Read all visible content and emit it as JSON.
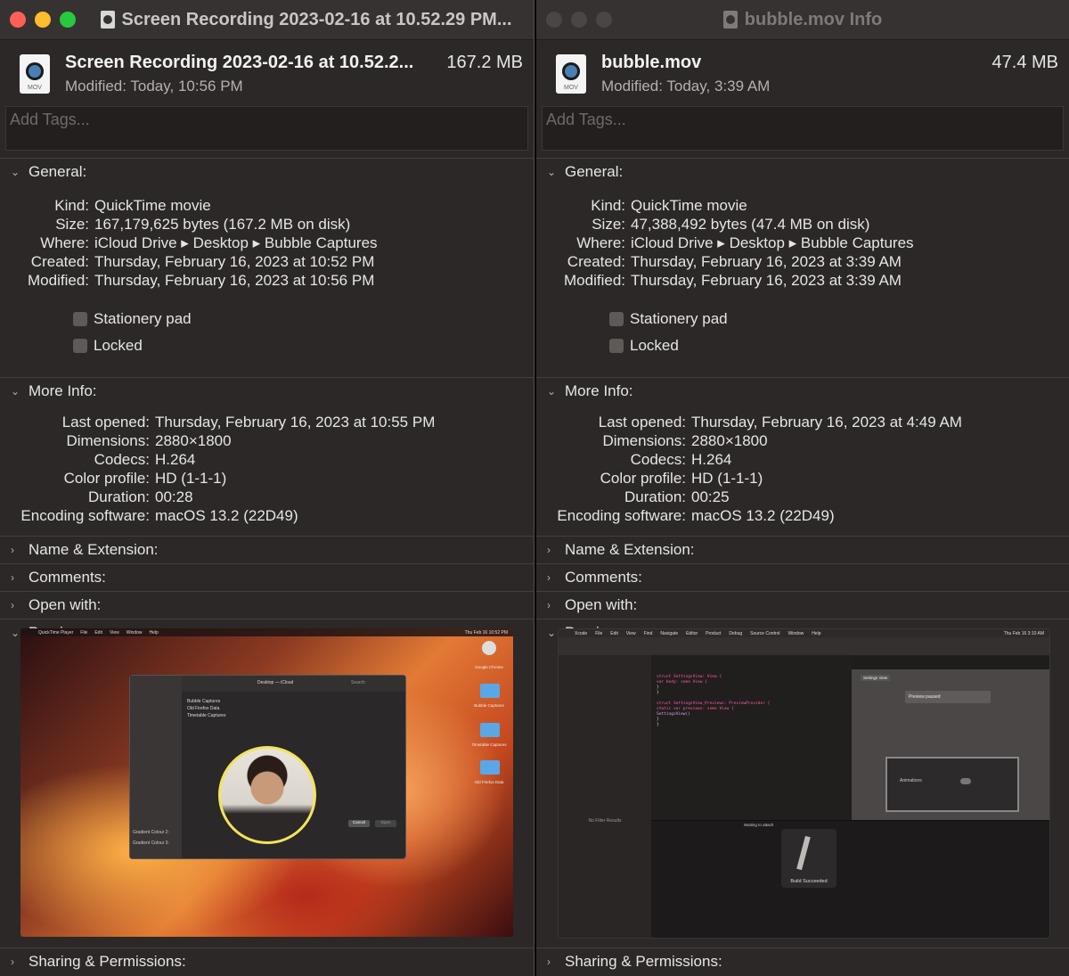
{
  "windows": [
    {
      "title": "Screen Recording 2023-02-16 at 10.52.29 PM...",
      "file_name": "Screen Recording 2023-02-16 at 10.52.2...",
      "size": "167.2 MB",
      "modified_line": "Modified:  Today, 10:56 PM",
      "tags_placeholder": "Add Tags...",
      "sections": {
        "general": "General:",
        "more_info": "More Info:",
        "name_ext": "Name & Extension:",
        "comments": "Comments:",
        "open_with": "Open with:",
        "preview": "Preview:",
        "sharing": "Sharing & Permissions:"
      },
      "general": {
        "kind_k": "Kind:",
        "kind": "QuickTime movie",
        "size_k": "Size:",
        "size": "167,179,625 bytes (167.2 MB on disk)",
        "where_k": "Where:",
        "where": "iCloud Drive ▸ Desktop ▸ Bubble Captures",
        "created_k": "Created:",
        "created": "Thursday, February 16, 2023 at 10:52 PM",
        "modified_k": "Modified:",
        "modified": "Thursday, February 16, 2023 at 10:56 PM",
        "stationery": "Stationery pad",
        "locked": "Locked"
      },
      "more_info": {
        "last_opened_k": "Last opened:",
        "last_opened": "Thursday, February 16, 2023 at 10:55 PM",
        "dimensions_k": "Dimensions:",
        "dimensions": "2880×1800",
        "codecs_k": "Codecs:",
        "codecs": "H.264",
        "color_profile_k": "Color profile:",
        "color_profile": "HD (1-1-1)",
        "duration_k": "Duration:",
        "duration": "00:28",
        "encoding_k": "Encoding software:",
        "encoding": "macOS 13.2 (22D49)"
      },
      "preview": {
        "menubar": [
          "QuickTime Player",
          "File",
          "Edit",
          "View",
          "Window",
          "Help"
        ],
        "clock": "Thu Feb 16  10:52 PM",
        "folders": [
          "Bubble Captures",
          "Old Firefox Data",
          "Timetable Captures"
        ],
        "desktop_icons": [
          "Google Chrome",
          "Bubble Captures",
          "Timetable Captures",
          "Old Firefox Data"
        ],
        "gradients": [
          "Gradient Colour 2:",
          "Gradient Colour 3:"
        ],
        "path": "Desktop — iCloud",
        "search": "Search",
        "cancel": "Cancel",
        "open": "Open"
      }
    },
    {
      "title": "bubble.mov Info",
      "file_name": "bubble.mov",
      "size": "47.4 MB",
      "modified_line": "Modified:  Today, 3:39 AM",
      "tags_placeholder": "Add Tags...",
      "sections": {
        "general": "General:",
        "more_info": "More Info:",
        "name_ext": "Name & Extension:",
        "comments": "Comments:",
        "open_with": "Open with:",
        "preview": "Preview:",
        "sharing": "Sharing & Permissions:"
      },
      "general": {
        "kind_k": "Kind:",
        "kind": "QuickTime movie",
        "size_k": "Size:",
        "size": "47,388,492 bytes (47.4 MB on disk)",
        "where_k": "Where:",
        "where": "iCloud Drive ▸ Desktop ▸ Bubble Captures",
        "created_k": "Created:",
        "created": "Thursday, February 16, 2023 at 3:39 AM",
        "modified_k": "Modified:",
        "modified": "Thursday, February 16, 2023 at 3:39 AM",
        "stationery": "Stationery pad",
        "locked": "Locked"
      },
      "more_info": {
        "last_opened_k": "Last opened:",
        "last_opened": "Thursday, February 16, 2023 at 4:49 AM",
        "dimensions_k": "Dimensions:",
        "dimensions": "2880×1800",
        "codecs_k": "Codecs:",
        "codecs": "H.264",
        "color_profile_k": "Color profile:",
        "color_profile": "HD (1-1-1)",
        "duration_k": "Duration:",
        "duration": "00:25",
        "encoding_k": "Encoding software:",
        "encoding": "macOS 13.2 (22D49)"
      },
      "preview": {
        "menubar": [
          "Xcode",
          "File",
          "Edit",
          "View",
          "Find",
          "Navigate",
          "Editor",
          "Product",
          "Debug",
          "Source Control",
          "Window",
          "Help"
        ],
        "clock": "Thu Feb 16  3:10 AM",
        "no_filter": "No Filter Results",
        "preview_paused": "Preview paused",
        "settings_view": "Settings View",
        "animations": "Animations",
        "build_succeeded": "Build Succeeded",
        "attach": "Waiting to attach",
        "code": [
          "struct SettingsView: View {",
          "  var body: some View {",
          "  }",
          "}",
          "struct SettingsView_Previews: PreviewProvider {",
          "  static var previews: some View {",
          "    SettingsView()",
          "  }",
          "}"
        ]
      }
    }
  ],
  "colors": {
    "close": "#fe5f57",
    "minimize": "#febc2e",
    "zoom": "#28c840",
    "panel": "#2b2827"
  },
  "icons": {
    "doc": "movie-document-icon",
    "disclosure": "chevron-icon"
  }
}
